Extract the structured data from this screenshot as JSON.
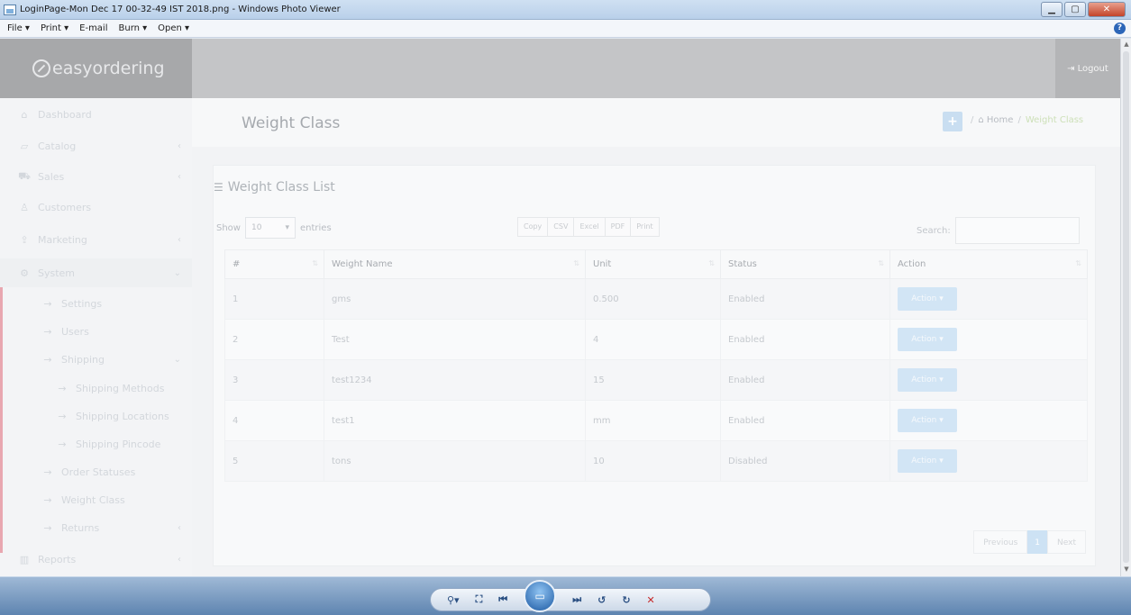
{
  "window": {
    "title": "LoginPage-Mon Dec 17 00-32-49 IST 2018.png - Windows Photo Viewer",
    "menu": [
      "File ▾",
      "Print ▾",
      "E-mail",
      "Burn ▾",
      "Open ▾"
    ]
  },
  "app": {
    "brand": "easyordering",
    "logout": "Logout"
  },
  "sidebar": {
    "items": [
      {
        "label": "Dashboard",
        "icon": "dashboard-icon",
        "glyph": "⌂"
      },
      {
        "label": "Catalog",
        "icon": "tag-icon",
        "glyph": "▱",
        "chevron": "‹"
      },
      {
        "label": "Sales",
        "icon": "cart-icon",
        "glyph": "⛟",
        "chevron": "‹"
      },
      {
        "label": "Customers",
        "icon": "user-icon",
        "glyph": "♙"
      },
      {
        "label": "Marketing",
        "icon": "share-icon",
        "glyph": "⇪",
        "chevron": "‹"
      },
      {
        "label": "System",
        "icon": "gear-icon",
        "glyph": "⚙",
        "chevron": "⌄"
      },
      {
        "label": "Settings",
        "glyph": "→"
      },
      {
        "label": "Users",
        "glyph": "→"
      },
      {
        "label": "Shipping",
        "glyph": "→",
        "chevron": "⌄"
      },
      {
        "label": "Shipping Methods",
        "glyph": "→"
      },
      {
        "label": "Shipping Locations",
        "glyph": "→"
      },
      {
        "label": "Shipping Pincode",
        "glyph": "→"
      },
      {
        "label": "Order Statuses",
        "glyph": "→"
      },
      {
        "label": "Weight Class",
        "glyph": "→"
      },
      {
        "label": "Returns",
        "glyph": "→",
        "chevron": "‹"
      },
      {
        "label": "Reports",
        "icon": "bar-chart-icon",
        "glyph": "▥",
        "chevron": "‹"
      }
    ]
  },
  "page": {
    "title": "Weight Class",
    "add_label": "+",
    "breadcrumb": [
      "/",
      "Home",
      "/",
      "Weight Class"
    ]
  },
  "panel": {
    "title": "Weight Class List",
    "show_label": "Show",
    "entries_value": "10",
    "entries_label": "entries",
    "export_buttons": [
      "Copy",
      "CSV",
      "Excel",
      "PDF",
      "Print"
    ],
    "search_label": "Search:",
    "search_value": ""
  },
  "table": {
    "columns": [
      "#",
      "Weight Name",
      "Unit",
      "Status",
      "Action"
    ],
    "rows": [
      [
        "1",
        "gms",
        "0.500",
        "Enabled",
        "Action ▾"
      ],
      [
        "2",
        "Test",
        "4",
        "Enabled",
        "Action ▾"
      ],
      [
        "3",
        "test1234",
        "15",
        "Enabled",
        "Action ▾"
      ],
      [
        "4",
        "test1",
        "mm",
        "Enabled",
        "Action ▾"
      ],
      [
        "5",
        "tons",
        "10",
        "Disabled",
        "Action ▾"
      ]
    ]
  },
  "pagination": {
    "previous": "Previous",
    "current": "1",
    "next": "Next"
  },
  "colors": {
    "accent": "#cde2f4",
    "topnav": "#c4c5c7",
    "logo_bg": "#a7a8aa"
  }
}
